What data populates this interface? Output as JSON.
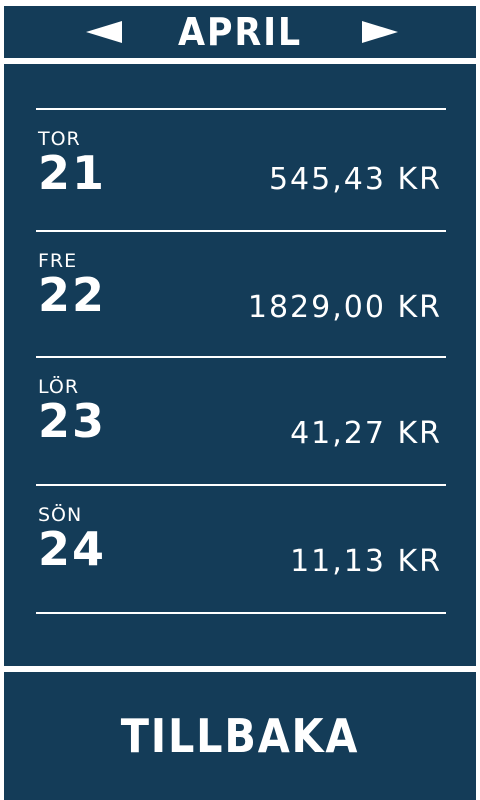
{
  "header": {
    "month": "APRIL",
    "prev_icon": "triangle-left-icon",
    "next_icon": "triangle-right-icon"
  },
  "days": [
    {
      "weekday": "TOR",
      "day": "21",
      "amount": "545,43 KR"
    },
    {
      "weekday": "FRE",
      "day": "22",
      "amount": "1829,00 KR"
    },
    {
      "weekday": "LÖR",
      "day": "23",
      "amount": "41,27 KR"
    },
    {
      "weekday": "SÖN",
      "day": "24",
      "amount": "11,13 KR"
    }
  ],
  "footer": {
    "back_label": "TILLBAKA"
  },
  "colors": {
    "panel": "#143c58",
    "background": "#ffffff",
    "text": "#ffffff"
  }
}
